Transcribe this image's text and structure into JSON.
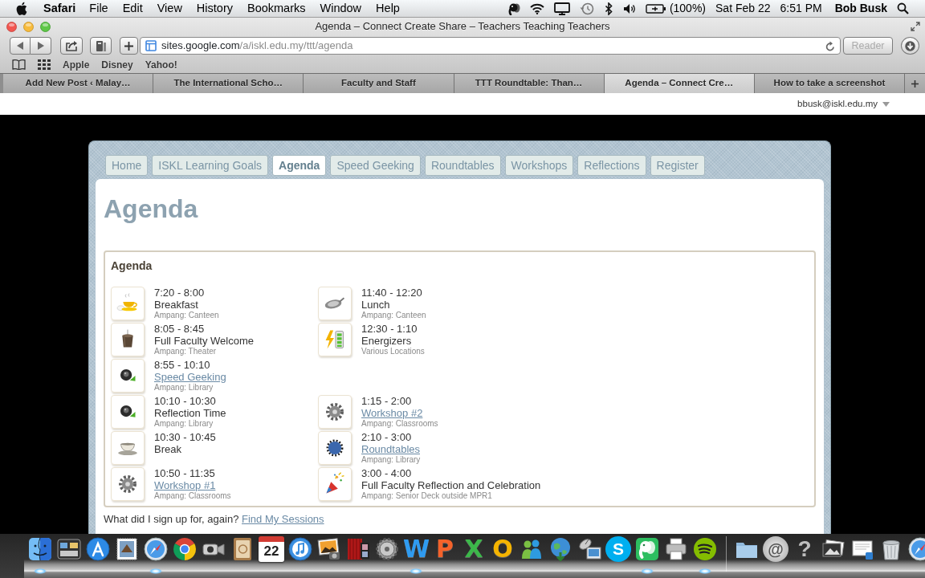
{
  "menu_bar": {
    "app_name": "Safari",
    "menus": [
      "File",
      "Edit",
      "View",
      "History",
      "Bookmarks",
      "Window",
      "Help"
    ],
    "battery_text": "(100%)",
    "date": "Sat Feb 22",
    "time": "6:51 PM",
    "user": "Bob Busk"
  },
  "browser": {
    "title": "Agenda – Connect Create Share – Teachers Teaching Teachers",
    "url_host": "sites.google.com",
    "url_path": "/a/iskl.edu.my/ttt/agenda",
    "reader": {
      "label": "Reader",
      "disabled": true
    },
    "bookmarks": [
      "Apple",
      "Disney",
      "Yahoo!"
    ],
    "tabs": [
      {
        "label": "Add New Post ‹ Malay…",
        "selected": false
      },
      {
        "label": "The International Scho…",
        "selected": false
      },
      {
        "label": "Faculty and Staff",
        "selected": false
      },
      {
        "label": "TTT Roundtable: Than…",
        "selected": false
      },
      {
        "label": "Agenda – Connect Cre…",
        "selected": true
      },
      {
        "label": "How to take a screenshot",
        "selected": false
      }
    ]
  },
  "page": {
    "account": "bbusk@iskl.edu.my",
    "nav": [
      {
        "label": "Home",
        "selected": false
      },
      {
        "label": "ISKL Learning Goals",
        "selected": false
      },
      {
        "label": "Agenda",
        "selected": true
      },
      {
        "label": "Speed Geeking",
        "selected": false
      },
      {
        "label": "Roundtables",
        "selected": false
      },
      {
        "label": "Workshops",
        "selected": false
      },
      {
        "label": "Reflections",
        "selected": false
      },
      {
        "label": "Register",
        "selected": false
      }
    ],
    "heading": "Agenda",
    "agenda": {
      "title": "Agenda",
      "rows": [
        {
          "left": {
            "kind": "breakfast",
            "time": "7:20 - 8:00",
            "title": "Breakfast",
            "link": false,
            "location": "Ampang: Canteen"
          },
          "right": {
            "kind": "lunch",
            "time": "11:40 - 12:20",
            "title": "Lunch",
            "link": false,
            "location": "Ampang: Canteen"
          }
        },
        {
          "left": {
            "kind": "welcome",
            "time": "8:05 - 8:45",
            "title": "Full Faculty Welcome",
            "link": false,
            "location": "Ampang: Theater"
          },
          "right": {
            "kind": "energizer",
            "time": "12:30 - 1:10",
            "title": "Energizers",
            "link": false,
            "location": "Various Locations"
          }
        },
        {
          "left": {
            "kind": "geeking",
            "time": "8:55 - 10:10",
            "title": "Speed Geeking",
            "link": true,
            "location": "Ampang: Library"
          }
        },
        {
          "left": {
            "kind": "reflection",
            "time": "10:10 - 10:30",
            "title": "Reflection Time",
            "link": false,
            "location": "Ampang: Library"
          },
          "right": {
            "kind": "workshop",
            "time": "1:15 - 2:00",
            "title": "Workshop #2",
            "link": true,
            "location": "Ampang: Classrooms"
          }
        },
        {
          "left": {
            "kind": "break",
            "time": "10:30 - 10:45",
            "title": "Break",
            "link": false
          },
          "right": {
            "kind": "roundtable",
            "time": "2:10 - 3:00",
            "title": "Roundtables",
            "link": true,
            "location": "Ampang: Library"
          }
        },
        {
          "left": {
            "kind": "workshop",
            "time": "10:50 - 11:35",
            "title": "Workshop #1",
            "link": true,
            "location": "Ampang: Classrooms"
          },
          "right": {
            "kind": "celebration",
            "time": "3:00 - 4:00",
            "title": "Full Faculty Reflection and Celebration",
            "link": false,
            "location": "Ampang: Senior Deck outside MPR1"
          }
        }
      ]
    },
    "footer": {
      "text": "What did I sign up for, again?",
      "link": "Find My Sessions"
    }
  },
  "dock": [
    {
      "kind": "face",
      "running": true
    },
    {
      "kind": "windows",
      "running": false
    },
    {
      "kind": "appstore",
      "running": false
    },
    {
      "kind": "stamp",
      "running": false
    },
    {
      "kind": "compass",
      "running": true
    },
    {
      "kind": "chrome",
      "running": false
    },
    {
      "kind": "camera",
      "running": false
    },
    {
      "kind": "addressbook",
      "running": false
    },
    {
      "kind": "calendar",
      "glyph": "22",
      "running": false
    },
    {
      "kind": "music",
      "running": false
    },
    {
      "kind": "photo",
      "running": false
    },
    {
      "kind": "film",
      "running": false
    },
    {
      "kind": "gear",
      "running": false
    },
    {
      "kind": "letter",
      "glyph": "W",
      "color": "#2f9bf0",
      "running": true
    },
    {
      "kind": "letter",
      "glyph": "P",
      "color": "#f5622a",
      "running": false
    },
    {
      "kind": "letter",
      "glyph": "X",
      "color": "#3cb84a",
      "running": false
    },
    {
      "kind": "letter",
      "glyph": "O",
      "color": "#f5b400",
      "running": false
    },
    {
      "kind": "people",
      "running": false
    },
    {
      "kind": "globe",
      "running": false
    },
    {
      "kind": "dish",
      "running": false
    },
    {
      "kind": "disc",
      "glyph": "S",
      "running": false
    },
    {
      "kind": "elephant",
      "running": true
    },
    {
      "kind": "printer",
      "running": false
    },
    {
      "kind": "waves",
      "running": true
    },
    {
      "kind": "separator"
    },
    {
      "kind": "folder",
      "running": false
    },
    {
      "kind": "metal",
      "glyph": "@",
      "running": false
    },
    {
      "kind": "plain",
      "glyph": "?",
      "running": false
    },
    {
      "kind": "stack",
      "running": false
    },
    {
      "kind": "document",
      "running": false
    },
    {
      "kind": "trash",
      "running": false
    },
    {
      "kind": "compass",
      "running": false
    }
  ]
}
